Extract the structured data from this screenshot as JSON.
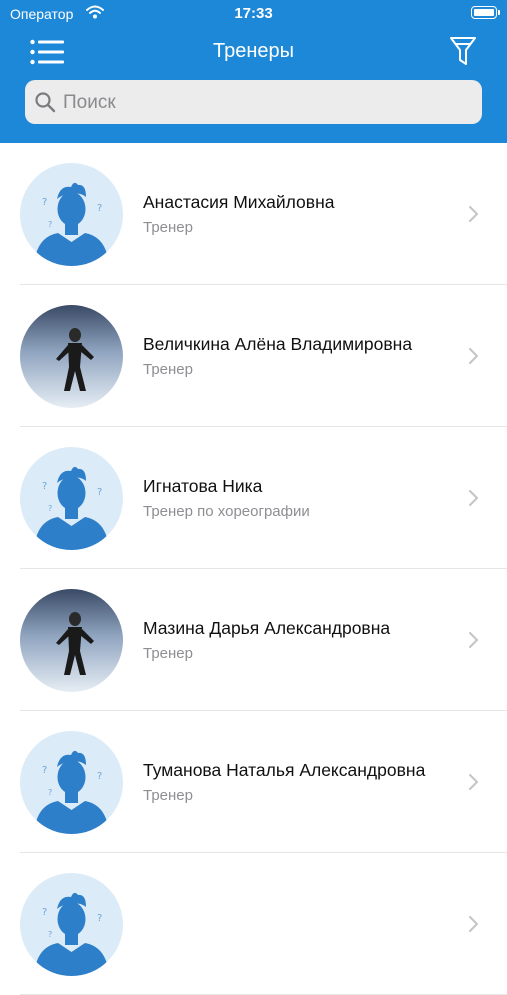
{
  "status_bar": {
    "carrier": "Оператор",
    "time": "17:33"
  },
  "header": {
    "title": "Тренеры"
  },
  "search": {
    "placeholder": "Поиск",
    "value": ""
  },
  "trainers": [
    {
      "name": "Анастасия Михайловна",
      "role": "Тренер",
      "avatar": "placeholder"
    },
    {
      "name": "Величкина Алёна Владимировна",
      "role": "Тренер",
      "avatar": "photo"
    },
    {
      "name": "Игнатова Ника",
      "role": "Тренер по хореографии",
      "avatar": "placeholder"
    },
    {
      "name": "Мазина Дарья Александровна",
      "role": "Тренер",
      "avatar": "photo"
    },
    {
      "name": "Туманова Наталья Александровна",
      "role": "Тренер",
      "avatar": "placeholder"
    },
    {
      "name": "",
      "role": "",
      "avatar": "placeholder"
    }
  ],
  "colors": {
    "accent": "#1e88d8",
    "avatar_bg": "#dcebf8",
    "avatar_figure": "#2d7fc9"
  }
}
